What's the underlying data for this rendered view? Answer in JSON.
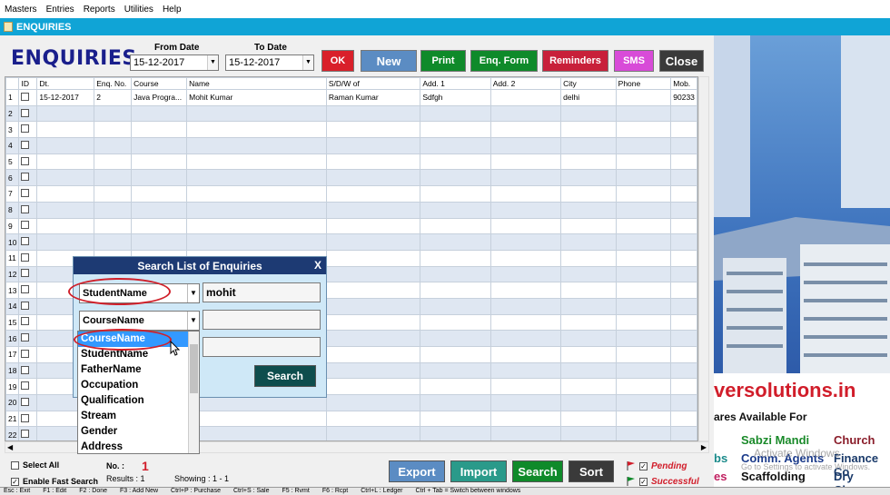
{
  "menu": [
    "Masters",
    "Entries",
    "Reports",
    "Utilities",
    "Help"
  ],
  "window_title": "ENQUIRIES",
  "heading": "ENQUIRIES",
  "from_date": {
    "label": "From Date",
    "value": "15-12-2017"
  },
  "to_date": {
    "label": "To Date",
    "value": "15-12-2017"
  },
  "toolbar": {
    "ok": "OK",
    "new": "New",
    "print": "Print",
    "enq_form": "Enq. Form",
    "reminders": "Reminders",
    "sms": "SMS",
    "close": "Close"
  },
  "colors": {
    "ok": "#d9202a",
    "new": "#5b8cc3",
    "print": "#0f8a2a",
    "enq_form": "#0f8a2a",
    "reminders": "#c8203a",
    "sms": "#d84bd8",
    "close": "#3a3a3a"
  },
  "grid": {
    "columns": [
      "ID",
      "Dt.",
      "Enq. No.",
      "Course",
      "Name",
      "S/D/W of",
      "Add. 1",
      "Add. 2",
      "City",
      "Phone",
      "Mob."
    ],
    "row_numbers": [
      "1",
      "2",
      "3",
      "4",
      "5",
      "6",
      "7",
      "8",
      "9",
      "10",
      "11",
      "12",
      "13",
      "14",
      "15",
      "16",
      "17",
      "18",
      "19",
      "20",
      "21",
      "22"
    ],
    "first_row": {
      "id": "1",
      "id_extra": ":",
      "dt": "15-12-2017",
      "enq_no": "2",
      "course": "Java Progra...",
      "name": "Mohit Kumar",
      "sdw": "Raman Kumar",
      "add1": "Sdfgh",
      "add2": "",
      "city": "delhi",
      "phone": "",
      "mob": "90233"
    }
  },
  "search_dialog": {
    "title": "Search List of Enquiries",
    "close": "X",
    "field1": "StudentName",
    "value1": "mohit",
    "field2": "CourseName",
    "search_button": "Search",
    "dropdown_options": [
      "CourseName",
      "StudentName",
      "FatherName",
      "Occupation",
      "Qualification",
      "Stream",
      "Gender",
      "Address"
    ]
  },
  "bottom": {
    "select_all": "Select All",
    "enable_fast_search": "Enable Fast Search",
    "no_label": "No. :",
    "no_value": "1",
    "results": "Results : 1",
    "showing": "Showing :  1 - 1",
    "export": "Export",
    "import": "Import",
    "search": "Search",
    "sort": "Sort",
    "pending": "Pending",
    "successful": "Successful"
  },
  "status_bar": [
    "Esc : Exit",
    "F1 : Edit",
    "F2 : Done",
    "F3 : Add New",
    "Ctrl+P : Purchase",
    "Ctrl+S : Sale",
    "F5 : Rvmt",
    "F6 : Rcpt",
    "Ctrl+L : Ledger",
    "Ctrl + Tab = Switch between windows"
  ],
  "background_image": {
    "url_text": "versolutions.in",
    "available": "ares Available For",
    "items": [
      "Sabzi Mandi",
      "Church",
      "bs",
      "Comm. Agents",
      "Finance Co",
      "es",
      "Scaffolding",
      "Dry Cleane"
    ],
    "watermark1": "Activate Windows",
    "watermark2": "Go to Settings to activate Windows."
  }
}
